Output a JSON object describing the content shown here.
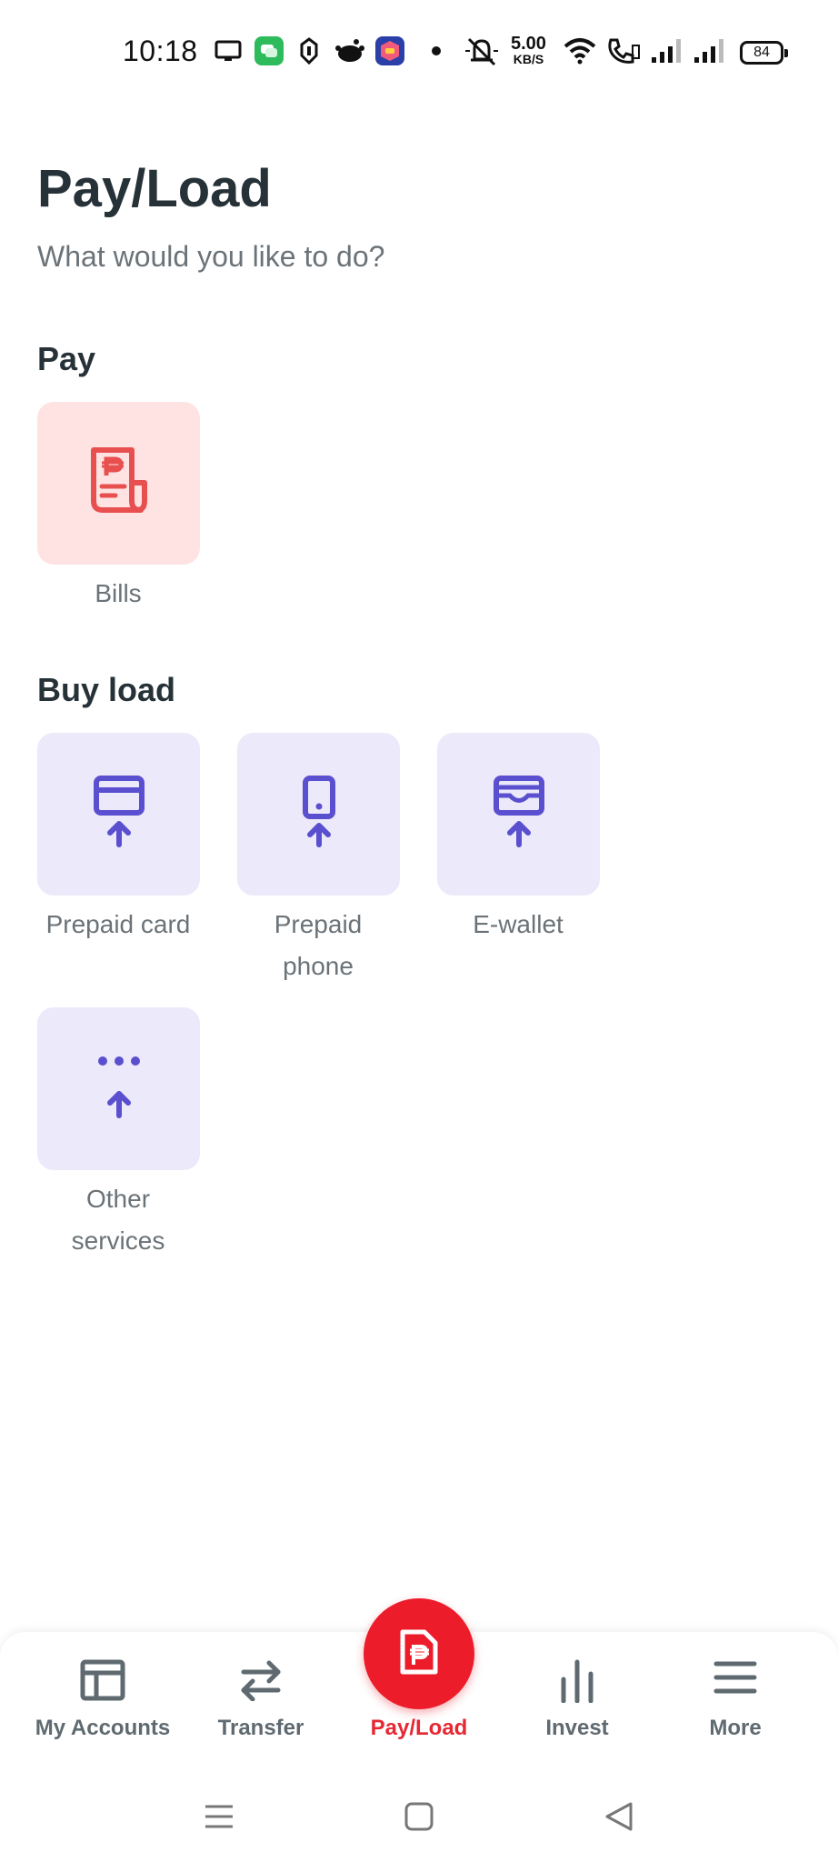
{
  "status_bar": {
    "time": "10:18",
    "net_speed_value": "5.00",
    "net_speed_unit": "KB/S",
    "battery": "84"
  },
  "header": {
    "title": "Pay/Load",
    "subtitle": "What would you like to do?"
  },
  "pay_section": {
    "title": "Pay",
    "items": [
      {
        "label": "Bills",
        "icon": "bill-icon"
      }
    ]
  },
  "buy_load_section": {
    "title": "Buy load",
    "items": [
      {
        "label": "Prepaid card",
        "icon": "card-upload-icon"
      },
      {
        "label": "Prepaid phone",
        "icon": "phone-upload-icon"
      },
      {
        "label": "E-wallet",
        "icon": "wallet-upload-icon"
      },
      {
        "label": "Other services",
        "icon": "more-upload-icon"
      }
    ]
  },
  "bottom_nav": {
    "items": [
      {
        "label": "My Accounts",
        "icon": "accounts-icon"
      },
      {
        "label": "Transfer",
        "icon": "transfer-icon"
      },
      {
        "label": "Pay/Load",
        "icon": "bill-icon",
        "active": true
      },
      {
        "label": "Invest",
        "icon": "invest-icon"
      },
      {
        "label": "More",
        "icon": "menu-icon"
      }
    ]
  },
  "colors": {
    "brand_red": "#ec1c2a",
    "icon_purple": "#5a4fcf",
    "tile_purple": "#ebe9fa",
    "tile_pink": "#ffe3e3",
    "bill_red": "#e85050"
  }
}
